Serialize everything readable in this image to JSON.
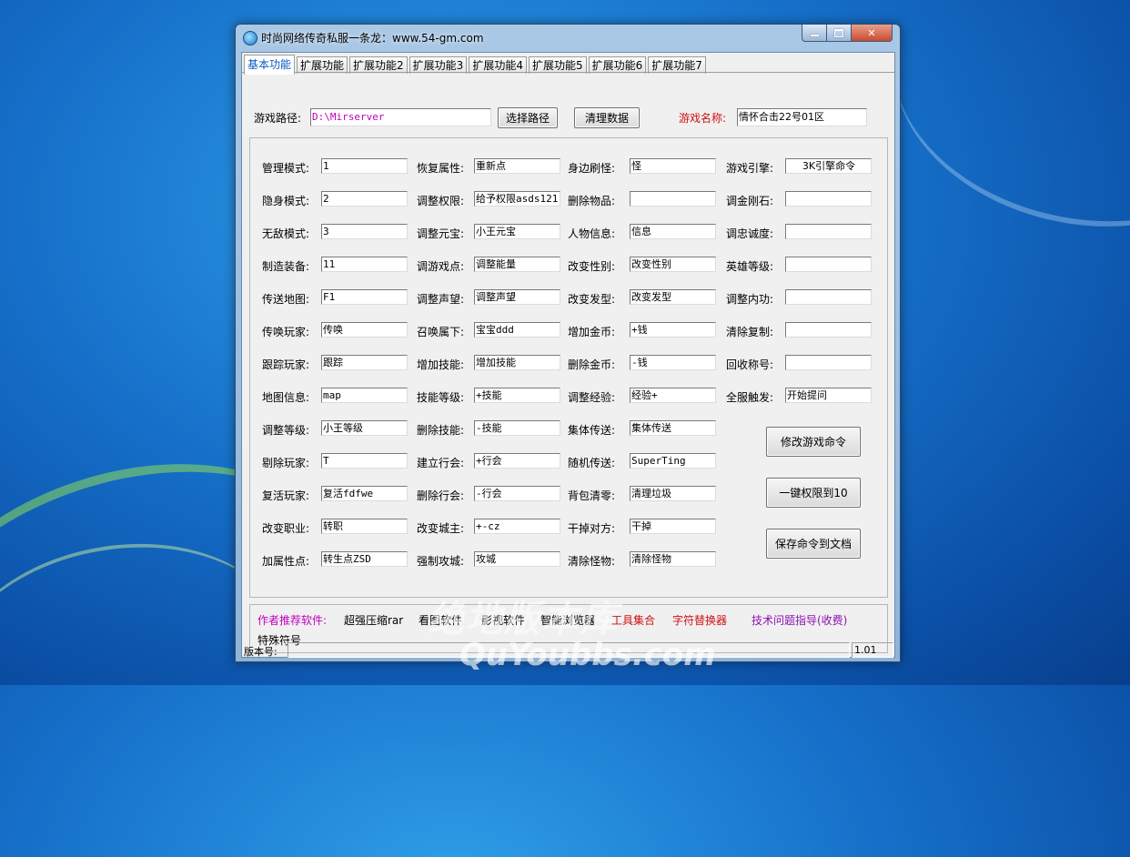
{
  "window": {
    "title": "时尚网络传奇私服一条龙：www.54-gm.com"
  },
  "tabs": [
    "基本功能",
    "扩展功能",
    "扩展功能2",
    "扩展功能3",
    "扩展功能4",
    "扩展功能5",
    "扩展功能6",
    "扩展功能7"
  ],
  "toolbar": {
    "path_label": "游戏路径:",
    "path_value": "D:\\Mirserver",
    "choose_path": "选择路径",
    "clean_data": "清理数据",
    "game_name_label": "游戏名称:",
    "game_name_value": "情怀合击22号01区"
  },
  "fields": {
    "col1": [
      {
        "label": "管理模式:",
        "value": "1"
      },
      {
        "label": "隐身模式:",
        "value": "2"
      },
      {
        "label": "无敌模式:",
        "value": "3"
      },
      {
        "label": "制造装备:",
        "value": "11"
      },
      {
        "label": "传送地图:",
        "value": "F1"
      },
      {
        "label": "传唤玩家:",
        "value": "传唤"
      },
      {
        "label": "跟踪玩家:",
        "value": "跟踪"
      },
      {
        "label": "地图信息:",
        "value": "map"
      },
      {
        "label": "调整等级:",
        "value": "小王等级"
      },
      {
        "label": "剔除玩家:",
        "value": "T"
      },
      {
        "label": "复活玩家:",
        "value": "复活fdfwe"
      },
      {
        "label": "改变职业:",
        "value": "转职"
      },
      {
        "label": "加属性点:",
        "value": "转生点ZSD"
      }
    ],
    "col2": [
      {
        "label": "恢复属性:",
        "value": "重新点"
      },
      {
        "label": "调整权限:",
        "value": "给予权限asds121;"
      },
      {
        "label": "调整元宝:",
        "value": "小王元宝"
      },
      {
        "label": "调游戏点:",
        "value": "调整能量"
      },
      {
        "label": "调整声望:",
        "value": "调整声望"
      },
      {
        "label": "召唤属下:",
        "value": "宝宝ddd"
      },
      {
        "label": "增加技能:",
        "value": "增加技能"
      },
      {
        "label": "技能等级:",
        "value": "+技能"
      },
      {
        "label": "删除技能:",
        "value": "-技能"
      },
      {
        "label": "建立行会:",
        "value": "+行会"
      },
      {
        "label": "删除行会:",
        "value": "-行会"
      },
      {
        "label": "改变城主:",
        "value": "+-cz"
      },
      {
        "label": "强制攻城:",
        "value": "攻城"
      }
    ],
    "col3": [
      {
        "label": "身边刷怪:",
        "value": "怪"
      },
      {
        "label": "删除物品:",
        "value": ""
      },
      {
        "label": "人物信息:",
        "value": "信息"
      },
      {
        "label": "改变性别:",
        "value": "改变性别"
      },
      {
        "label": "改变发型:",
        "value": "改变发型"
      },
      {
        "label": "增加金币:",
        "value": "+钱"
      },
      {
        "label": "删除金币:",
        "value": "-钱"
      },
      {
        "label": "调整经验:",
        "value": "经验+"
      },
      {
        "label": "集体传送:",
        "value": "集体传送"
      },
      {
        "label": "随机传送:",
        "value": "SuperTing"
      },
      {
        "label": "背包清零:",
        "value": "清理垃圾"
      },
      {
        "label": "干掉对方:",
        "value": "干掉"
      },
      {
        "label": "清除怪物:",
        "value": "清除怪物"
      }
    ],
    "col4": [
      {
        "label": "游戏引擎:",
        "value": "3K引擎命令"
      },
      {
        "label": "调金刚石:",
        "value": ""
      },
      {
        "label": "调忠诚度:",
        "value": ""
      },
      {
        "label": "英雄等级:",
        "value": ""
      },
      {
        "label": "调整内功:",
        "value": ""
      },
      {
        "label": "清除复制:",
        "value": ""
      },
      {
        "label": "回收称号:",
        "value": ""
      },
      {
        "label": "全服触发:",
        "value": "开始提问"
      }
    ]
  },
  "actions": {
    "modify_commands": "修改游戏命令",
    "one_click_permission": "一键权限到10",
    "save_to_doc": "保存命令到文档"
  },
  "recommend": {
    "label": "作者推荐软件:",
    "links": [
      {
        "text": "超强压缩rar",
        "color": "#000000"
      },
      {
        "text": "看图软件",
        "color": "#000000"
      },
      {
        "text": "影视软件",
        "color": "#000000"
      },
      {
        "text": "智能浏览器",
        "color": "#000000"
      },
      {
        "text": "工具集合",
        "color": "#d01010"
      },
      {
        "text": "字符替换器",
        "color": "#d01010"
      },
      {
        "text": "技术问题指导(收费)",
        "color": "#8a10b0"
      }
    ],
    "special_symbols": "特殊符号"
  },
  "status": {
    "version_label": "版本号:",
    "version_value": "1.01"
  },
  "watermark": {
    "line1": "绝地版本库",
    "line2": "QuYoubbs.com"
  },
  "colors": {
    "accent": "#0b59c5",
    "game_name_label": "#d01010",
    "path_text": "#c000c0",
    "recommend_label": "#c000c0"
  }
}
